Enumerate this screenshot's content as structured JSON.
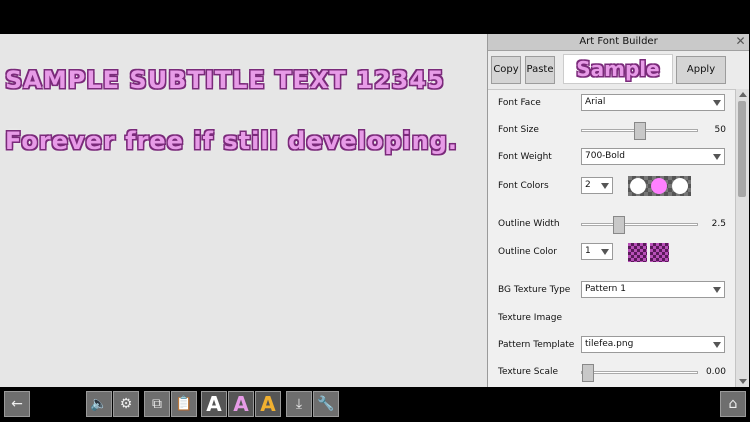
{
  "canvas": {
    "line1": "SAMPLE SUBTITLE TEXT 12345",
    "line2": "Forever free if still developing."
  },
  "panel": {
    "title": "Art Font Builder",
    "close_glyph": "✕",
    "toolbar": {
      "copy": "Copy",
      "paste": "Paste",
      "sample": "Sample",
      "apply": "Apply"
    },
    "rows": {
      "font_face": {
        "label": "Font Face",
        "value": "Arial"
      },
      "font_size": {
        "label": "Font Size",
        "value": "50",
        "level": 0.5
      },
      "font_weight": {
        "label": "Font Weight",
        "value": "700-Bold"
      },
      "font_colors": {
        "label": "Font Colors",
        "value": "2",
        "swatch_colors": [
          "#ffffff",
          "#ff80ff",
          "#ffffff"
        ]
      },
      "outline_width": {
        "label": "Outline Width",
        "value": "2.5",
        "level": 0.3
      },
      "outline_color": {
        "label": "Outline Color",
        "value": "1"
      },
      "bg_texture_type": {
        "label": "BG Texture Type",
        "value": "Pattern 1"
      },
      "texture_image": {
        "label": "Texture Image"
      },
      "pattern_template": {
        "label": "Pattern Template",
        "value": "tilefea.png"
      },
      "texture_scale": {
        "label": "Texture Scale",
        "value": "0.00",
        "level": 0.0
      }
    }
  },
  "bottom_bar": {
    "back": "←",
    "sound": "🔈",
    "settings": "⚙",
    "copy": "⧉",
    "paste": "📋",
    "font_a1": "A",
    "font_a2": "A",
    "font_a3": "A",
    "download": "⤓",
    "tools": "🔧",
    "home": "⌂"
  },
  "colors": {
    "accent_pink": "#e79be7",
    "outline_purple": "#7a2a7a"
  }
}
